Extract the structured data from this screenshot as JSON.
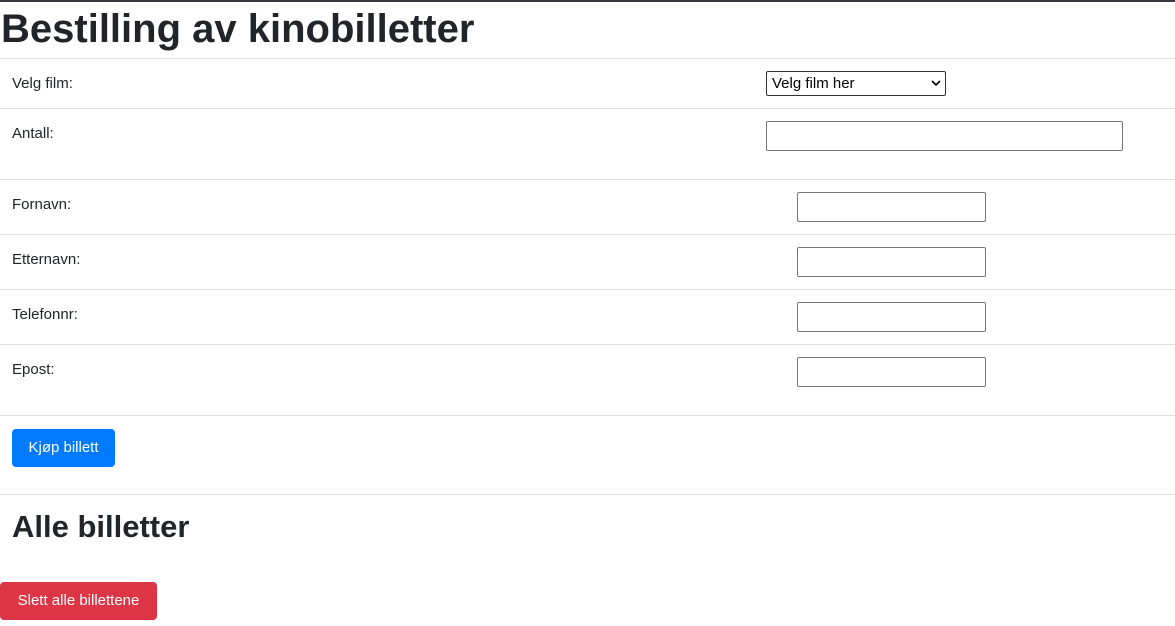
{
  "form": {
    "title": "Bestilling av kinobilletter",
    "film": {
      "label": "Velg film:",
      "selected": "Velg film her"
    },
    "antall": {
      "label": "Antall:",
      "value": ""
    },
    "fornavn": {
      "label": "Fornavn:",
      "value": ""
    },
    "etternavn": {
      "label": "Etternavn:",
      "value": ""
    },
    "telefonnr": {
      "label": "Telefonnr:",
      "value": ""
    },
    "epost": {
      "label": "Epost:",
      "value": ""
    },
    "submit_label": "Kjøp billett"
  },
  "tickets": {
    "title": "Alle billetter",
    "delete_all_label": "Slett alle billettene"
  },
  "colors": {
    "primary": "#007bff",
    "danger": "#dc3545",
    "text": "#212529",
    "divider": "#dee2e6"
  }
}
